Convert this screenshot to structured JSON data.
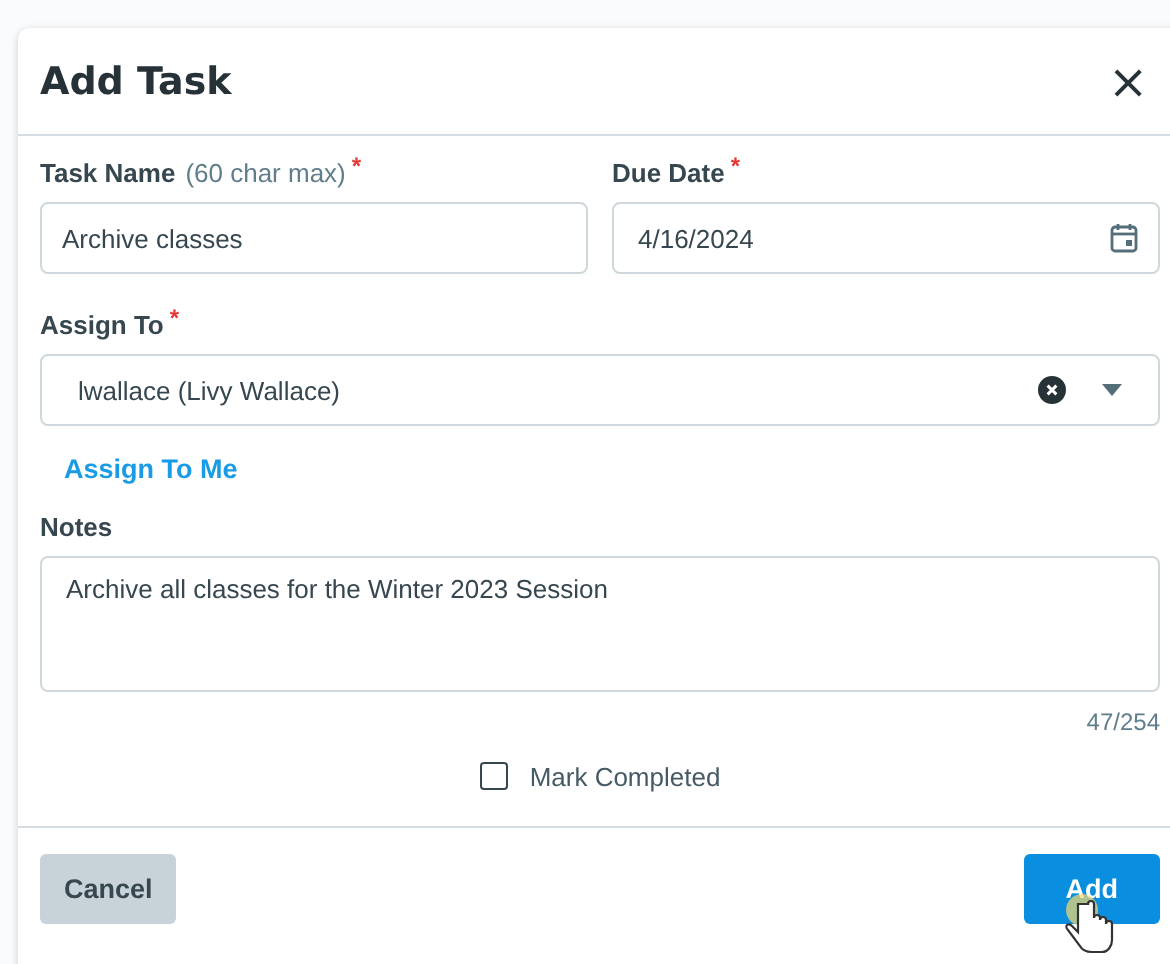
{
  "dialog": {
    "title": "Add Task",
    "close_icon": "×"
  },
  "task_name": {
    "label": "Task Name",
    "hint": "(60 char max)",
    "required_mark": "*",
    "value": "Archive classes"
  },
  "due_date": {
    "label": "Due Date",
    "required_mark": "*",
    "value": "4/16/2024"
  },
  "assign_to": {
    "label": "Assign To",
    "required_mark": "*",
    "value": "lwallace (Livy Wallace)"
  },
  "assign_to_me": "Assign To Me",
  "notes": {
    "label": "Notes",
    "value": "Archive all classes for the Winter 2023 Session",
    "counter": "47/254"
  },
  "mark_completed": {
    "label": "Mark Completed",
    "checked": false
  },
  "buttons": [
    {
      "label": "Cancel",
      "kind": "secondary"
    },
    {
      "label": "Add",
      "kind": "primary"
    }
  ]
}
